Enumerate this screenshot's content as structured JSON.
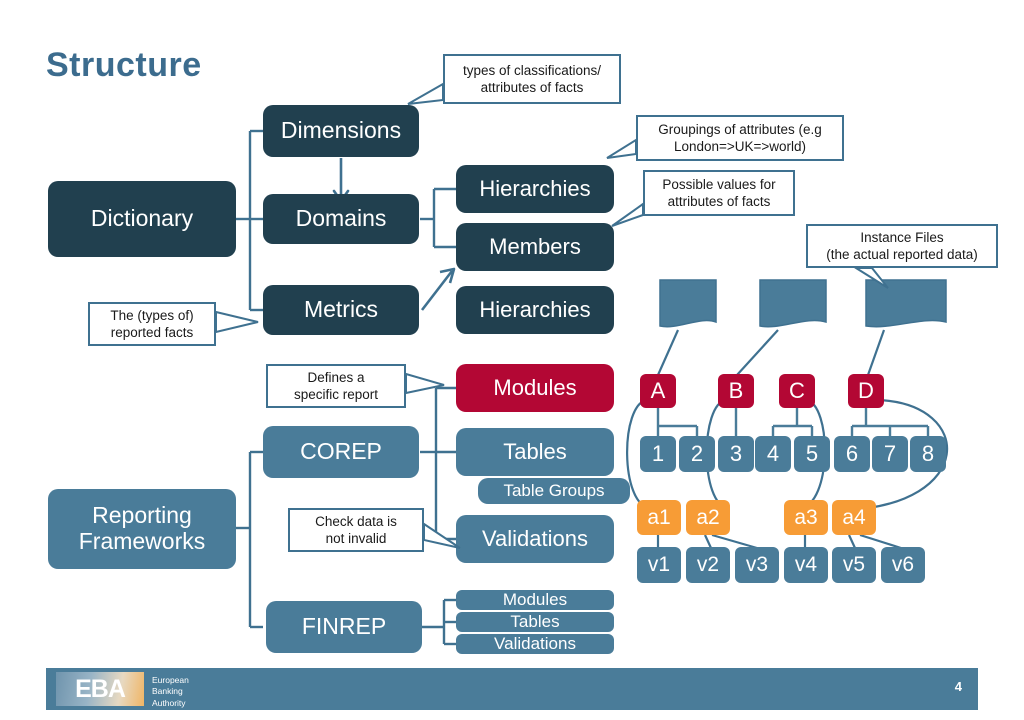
{
  "slide": {
    "title": "Structure",
    "page_number": "4",
    "accent_color": "#3c6c8e",
    "dark_color": "#21404f",
    "steel_color": "#4a7c99",
    "crimson_color": "#b30734",
    "orange_color": "#f79c36"
  },
  "dictionary_branch": {
    "root": "Dictionary",
    "children": [
      {
        "label": "Dimensions"
      },
      {
        "label": "Domains"
      },
      {
        "label": "Metrics"
      }
    ],
    "domain_children": [
      {
        "label": "Hierarchies"
      },
      {
        "label": "Members"
      }
    ],
    "metrics_children": [
      {
        "label": "Hierarchies"
      }
    ]
  },
  "frameworks_branch": {
    "root": "Reporting\nFrameworks",
    "children": [
      {
        "label": "COREP"
      },
      {
        "label": "FINREP"
      }
    ],
    "corep_children": [
      {
        "label": "Modules"
      },
      {
        "label": "Tables"
      },
      {
        "label": "Table Groups"
      },
      {
        "label": "Validations"
      }
    ],
    "finrep_children": [
      {
        "label": "Modules"
      },
      {
        "label": "Tables"
      },
      {
        "label": "Validations"
      }
    ]
  },
  "callouts": [
    {
      "name": "dimensions-callout",
      "text": "types of classifications/\nattributes  of facts"
    },
    {
      "name": "hierarchies-callout",
      "text": "Groupings of attributes (e.g\nLondon=>UK=>world)"
    },
    {
      "name": "members-callout",
      "text": "Possible values for\nattributes of facts"
    },
    {
      "name": "instance-files-callout",
      "text": "Instance Files\n(the actual reported data)"
    },
    {
      "name": "metrics-callout",
      "text": "The (types of)\nreported facts"
    },
    {
      "name": "modules-callout",
      "text": "Defines a\nspecific report"
    },
    {
      "name": "validations-callout",
      "text": "Check data is\nnot invalid"
    }
  ],
  "instance_tree": {
    "files": [
      "file-1",
      "file-2",
      "file-3"
    ],
    "modules": [
      "A",
      "B",
      "C",
      "D"
    ],
    "tables": [
      "1",
      "2",
      "3",
      "4",
      "5",
      "6",
      "7",
      "8"
    ],
    "table_groups": [
      "a1",
      "a2",
      "a3",
      "a4"
    ],
    "validations": [
      "v1",
      "v2",
      "v3",
      "v4",
      "v5",
      "v6"
    ]
  },
  "footer": {
    "logo": "EBA",
    "subtitle": "European\nBanking\nAuthority"
  }
}
